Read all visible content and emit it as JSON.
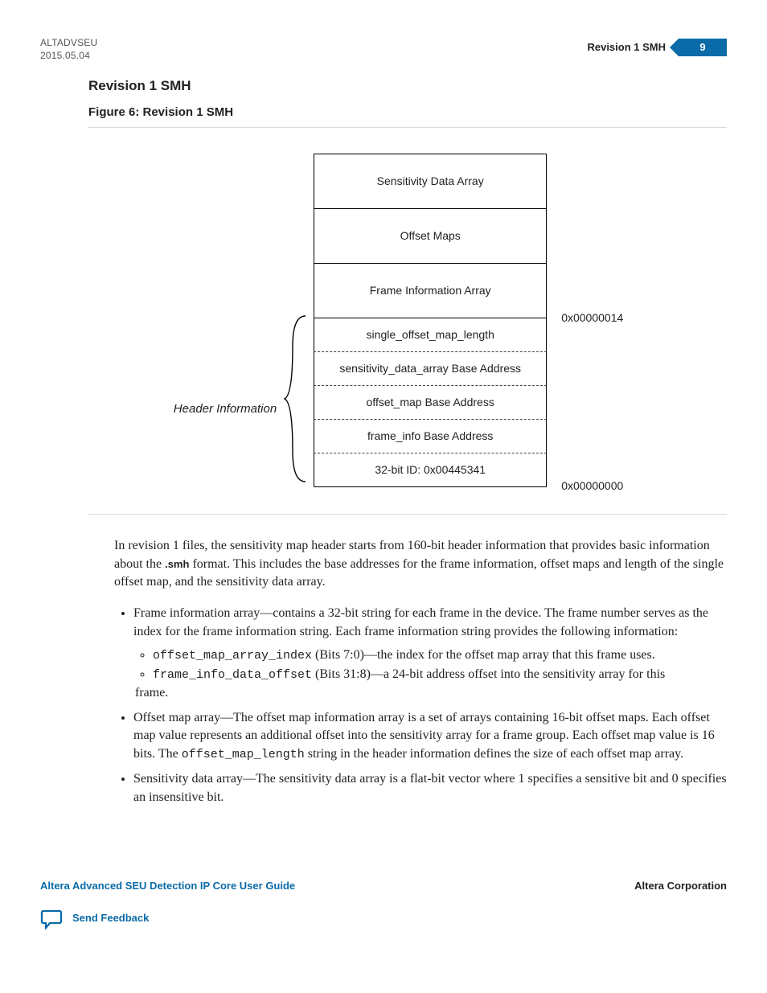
{
  "header": {
    "doc_id": "ALTADVSEU",
    "date": "2015.05.04",
    "running_title": "Revision 1 SMH",
    "page_number": "9"
  },
  "headings": {
    "section": "Revision 1 SMH",
    "figure": "Figure 6: Revision 1 SMH"
  },
  "diagram": {
    "brace_label": "Header Information",
    "blocks": [
      {
        "label": "Sensitivity Data Array",
        "height": "tall",
        "border": "solid"
      },
      {
        "label": "Offset Maps",
        "height": "tall",
        "border": "solid"
      },
      {
        "label": "Frame Information Array",
        "height": "tall",
        "border": "solid"
      },
      {
        "label": "single_offset_map_length",
        "height": "short",
        "border": "dashed"
      },
      {
        "label": "sensitivity_data_array Base Address",
        "height": "short",
        "border": "dashed"
      },
      {
        "label": "offset_map Base Address",
        "height": "short",
        "border": "dashed"
      },
      {
        "label": "frame_info Base Address",
        "height": "short",
        "border": "dashed"
      },
      {
        "label": "32-bit ID: 0x00445341",
        "height": "short",
        "border": "solid"
      }
    ],
    "addresses": {
      "upper": "0x00000014",
      "lower": "0x00000000"
    }
  },
  "body": {
    "intro_before": "In revision 1 files, the sensitivity map header starts from 160-bit header information that provides basic information about the ",
    "intro_mono": ".smh",
    "intro_after": " format. This includes the base addresses for the frame information, offset maps and length of the single offset map, and the sensitivity data array.",
    "bullets": {
      "frame_info": "Frame information array—contains a 32-bit string for each frame in the device. The frame number serves as the index for the frame information string. Each frame information string provides the following information:",
      "sub1_code": "offset_map_array_index",
      "sub1_text": " (Bits 7:0)—the index for the offset map array that this frame uses.",
      "sub2_code": "frame_info_data_offset",
      "sub2_text_a": " (Bits 31:8)—a 24-bit address offset into the sensitivity array for this",
      "sub2_text_b": "frame.",
      "offset_map_a": "Offset map array—The offset map information array is a set of arrays containing 16-bit offset maps. Each offset map value represents an additional offset into the sensitivity array for a frame group. Each offset map value is 16 bits. The ",
      "offset_map_code": "offset_map_length",
      "offset_map_b": " string in the header information defines the size of each offset map array.",
      "sensitivity": "Sensitivity data array—The sensitivity data array is a flat-bit vector where 1 specifies a sensitive bit and 0 specifies an insensitive bit."
    }
  },
  "footer": {
    "guide_title": "Altera Advanced SEU Detection IP Core User Guide",
    "corp": "Altera Corporation",
    "feedback": "Send Feedback"
  }
}
